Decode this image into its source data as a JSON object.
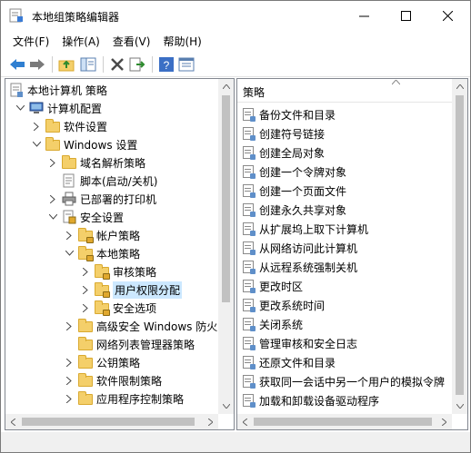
{
  "window": {
    "title": "本地组策略编辑器",
    "app_icon": "policy-editor-icon"
  },
  "menu": [
    "文件(F)",
    "操作(A)",
    "查看(V)",
    "帮助(H)"
  ],
  "toolbar": {
    "buttons": [
      "back-arrow-icon",
      "forward-arrow-icon",
      "up-folder-icon",
      "show-hide-tree-icon",
      "delete-icon",
      "export-list-icon",
      "help-icon",
      "properties-icon"
    ]
  },
  "tree": {
    "items": [
      {
        "label": "本地计算机 策略"
      },
      {
        "label": "计算机配置"
      },
      {
        "label": "软件设置"
      },
      {
        "label": "Windows 设置"
      },
      {
        "label": "域名解析策略"
      },
      {
        "label": "脚本(启动/关机)"
      },
      {
        "label": "已部署的打印机"
      },
      {
        "label": "安全设置"
      },
      {
        "label": "帐户策略"
      },
      {
        "label": "本地策略"
      },
      {
        "label": "审核策略"
      },
      {
        "label": "用户权限分配"
      },
      {
        "label": "安全选项"
      },
      {
        "label": "高级安全 Windows 防火"
      },
      {
        "label": "网络列表管理器策略"
      },
      {
        "label": "公钥策略"
      },
      {
        "label": "软件限制策略"
      },
      {
        "label": "应用程序控制策略"
      }
    ]
  },
  "policies": {
    "column_header": "策略",
    "items": [
      "备份文件和目录",
      "创建符号链接",
      "创建全局对象",
      "创建一个令牌对象",
      "创建一个页面文件",
      "创建永久共享对象",
      "从扩展坞上取下计算机",
      "从网络访问此计算机",
      "从远程系统强制关机",
      "更改时区",
      "更改系统时间",
      "关闭系统",
      "管理审核和安全日志",
      "还原文件和目录",
      "获取同一会话中另一个用户的模拟令牌",
      "加载和卸载设备驱动程序"
    ]
  },
  "colors": {
    "selection": "#cce8ff",
    "folder": "#f4cf6a",
    "scrollbar_thumb": "#c1c1c1"
  }
}
